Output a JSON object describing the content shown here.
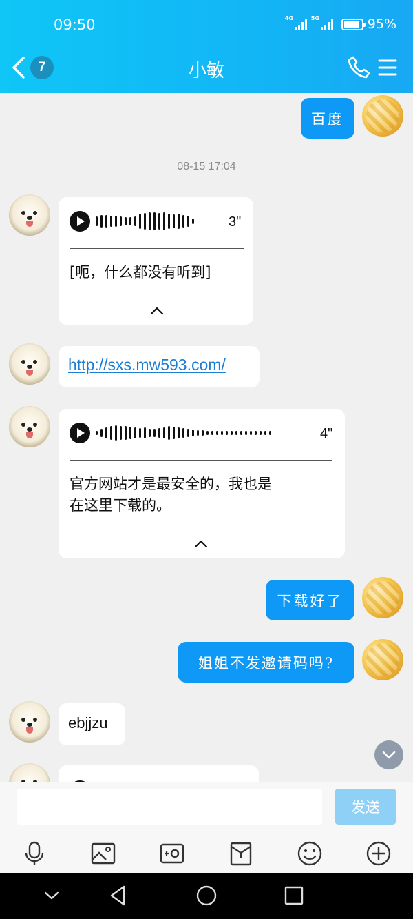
{
  "status_bar": {
    "time": "09:50",
    "signal_1_type": "4G",
    "signal_2_type": "5G",
    "battery": "95%"
  },
  "header": {
    "unread_count": "7",
    "contact_name": "小敏"
  },
  "messages": {
    "m1_text": "百度",
    "timestamp": "08-15 17:04",
    "m2_duration": "3\"",
    "m2_transcript": "[呃，什么都没有听到]",
    "m3_link": "http://sxs.mw593.com/",
    "m4_duration": "4\"",
    "m4_transcript_line1": "官方网站才是最安全的，我也是",
    "m4_transcript_line2": "在这里下载的。",
    "m5_text": "下载好了",
    "m6_text": "姐姐不发邀请码吗?",
    "m7_text": "ebjjzu"
  },
  "composer": {
    "input_value": "",
    "send_label": "发送"
  },
  "toolbar_icons": [
    "microphone-icon",
    "image-icon",
    "camera-icon",
    "red-packet-icon",
    "emoji-icon",
    "plus-icon"
  ],
  "colors": {
    "header": "#12b6f5",
    "bubble_sent": "#0d99f5",
    "bubble_received": "#ffffff",
    "background": "#f0f0f0",
    "send_button_disabled": "#8fd0f7"
  }
}
